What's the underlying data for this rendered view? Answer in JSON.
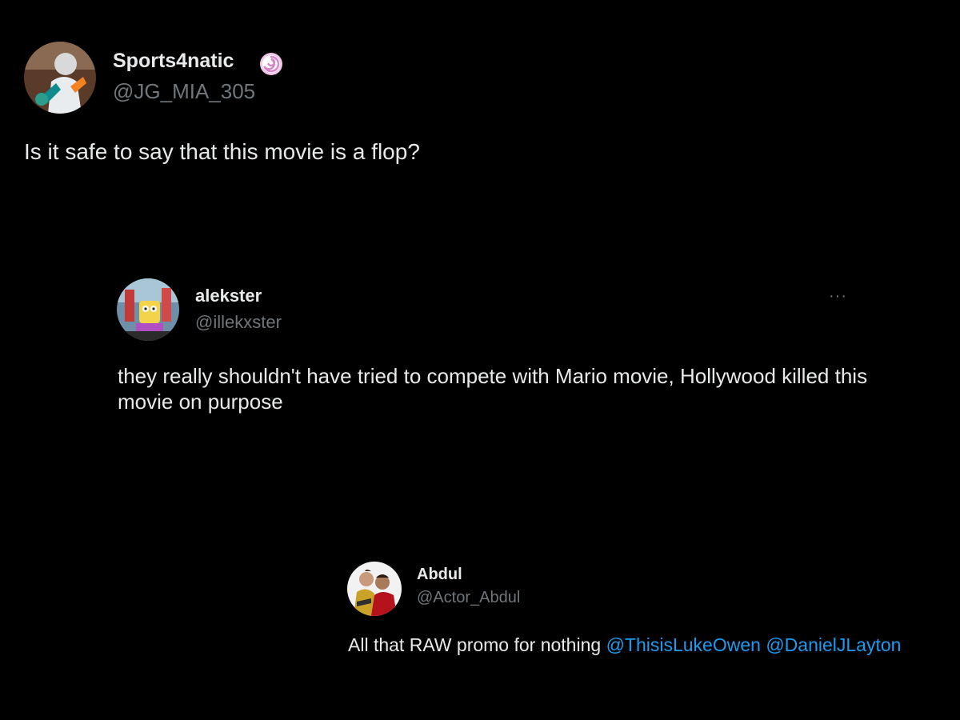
{
  "tweets": [
    {
      "display_name": "Sports4natic",
      "handle": "@JG_MIA_305",
      "badge_icon": "verified-badge-icon",
      "avatar_icon": "football-player-avatar",
      "text": "Is it safe to say that this movie is a flop?"
    },
    {
      "display_name": "alekster",
      "handle": "@illekxster",
      "more_label": "···",
      "avatar_icon": "cartoon-character-avatar",
      "text": "they really shouldn't have tried to compete with Mario movie, Hollywood killed this movie on purpose"
    },
    {
      "display_name": "Abdul",
      "handle": "@Actor_Abdul",
      "avatar_icon": "two-men-avatar",
      "text_plain": "All that RAW promo for nothing ",
      "mentions": [
        "@ThisisLukeOwen",
        "@DanielJLayton"
      ]
    }
  ],
  "colors": {
    "background": "#000000",
    "text_primary": "#e7e9ea",
    "text_secondary": "#71767b",
    "mention": "#1d9bf0",
    "badge": "#d884c8"
  }
}
